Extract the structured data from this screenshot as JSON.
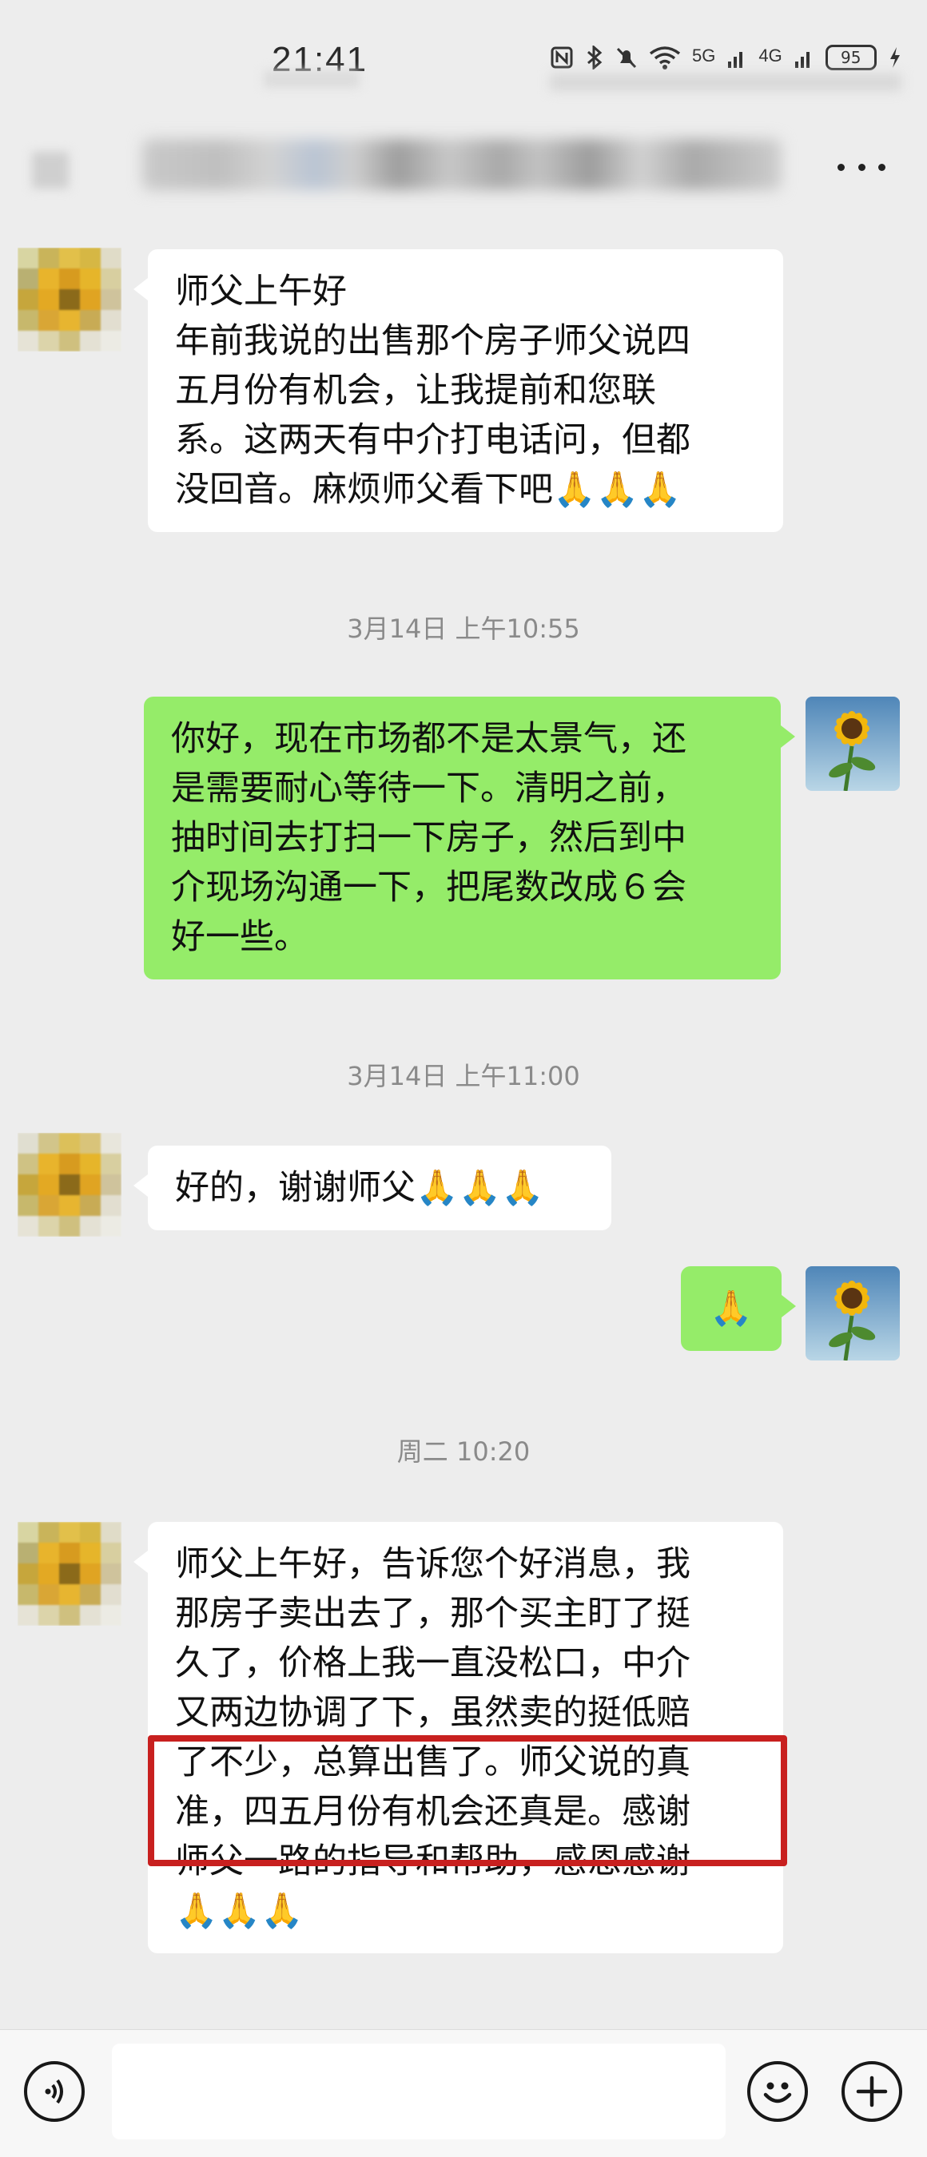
{
  "status": {
    "time": "21:41",
    "network_4g": "4G",
    "network_5g": "5G",
    "battery": "95"
  },
  "chat": {
    "messages": [
      {
        "side": "left",
        "lines": [
          "师父上午好",
          "年前我说的出售那个房子师父说四",
          "五月份有机会，让我提前和您联",
          "系。这两天有中介打电话问，但都",
          "没回音。麻烦师父看下吧🙏🙏🙏"
        ]
      },
      {
        "timestamp": "3月14日 上午10:55"
      },
      {
        "side": "right",
        "lines": [
          "你好，现在市场都不是太景气，还",
          "是需要耐心等待一下。清明之前，",
          "抽时间去打扫一下房子，然后到中",
          "介现场沟通一下，把尾数改成６会",
          "好一些。"
        ]
      },
      {
        "timestamp": "3月14日 上午11:00"
      },
      {
        "side": "left",
        "lines": [
          "好的，谢谢师父🙏🙏🙏"
        ]
      },
      {
        "side": "right",
        "lines": [
          "🙏"
        ]
      },
      {
        "timestamp": "周二 10:20"
      },
      {
        "side": "left",
        "lines": [
          "师父上午好，告诉您个好消息，我",
          "那房子卖出去了，那个买主盯了挺",
          "久了，价格上我一直没松口，中介",
          "又两边协调了下，虽然卖的挺低赔",
          "了不少，总算出售了。师父说的真",
          "准，四五月份有机会还真是。感谢",
          "师父一路的指导和帮助，感恩感谢",
          "🙏🙏🙏"
        ]
      }
    ]
  },
  "colors": {
    "background": "#ededed",
    "bubble_left": "#ffffff",
    "bubble_right": "#95ec69",
    "highlight": "#c8201f"
  },
  "icons": {
    "more": "more-dots-icon",
    "voice": "voice-icon",
    "emoji": "emoji-icon",
    "add": "plus-icon"
  }
}
